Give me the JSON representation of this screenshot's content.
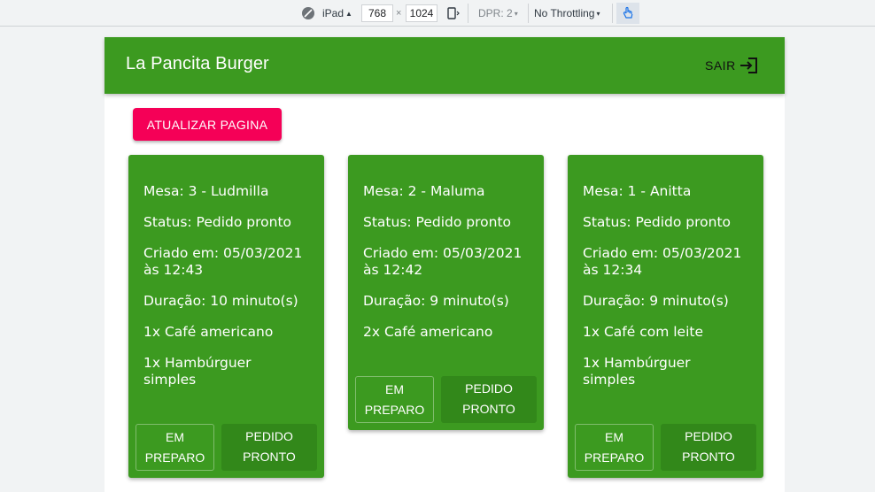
{
  "devtools": {
    "device": "iPad",
    "width": "768",
    "times": "×",
    "height": "1024",
    "dpr": "DPR: 2",
    "throttling": "No Throttling"
  },
  "app": {
    "title": "La Pancita Burger",
    "logout_label": "SAIR",
    "refresh_label": "ATUALIZAR PAGINA"
  },
  "orders": [
    {
      "table": "Mesa: 3 - Ludmilla",
      "status": "Status: Pedido pronto",
      "created_line1": "Criado em: 05/03/2021",
      "created_line2": "às 12:43",
      "duration": "Duração: 10 minuto(s)",
      "items": [
        {
          "line1": "1x Café americano",
          "line2": ""
        },
        {
          "line1": "1x Hambúrguer",
          "line2": "simples"
        }
      ],
      "btn_preparing_1": "EM",
      "btn_preparing_2": "PREPARO",
      "btn_ready_1": "PEDIDO",
      "btn_ready_2": "PRONTO"
    },
    {
      "table": "Mesa: 2 - Maluma",
      "status": "Status: Pedido pronto",
      "created_line1": "Criado em: 05/03/2021",
      "created_line2": "às 12:42",
      "duration": "Duração: 9 minuto(s)",
      "items": [
        {
          "line1": "2x Café americano",
          "line2": ""
        }
      ],
      "btn_preparing_1": "EM",
      "btn_preparing_2": "PREPARO",
      "btn_ready_1": "PEDIDO",
      "btn_ready_2": "PRONTO"
    },
    {
      "table": "Mesa: 1 - Anitta",
      "status": "Status: Pedido pronto",
      "created_line1": "Criado em: 05/03/2021",
      "created_line2": "às 12:34",
      "duration": "Duração: 9 minuto(s)",
      "items": [
        {
          "line1": "1x Café com leite",
          "line2": ""
        },
        {
          "line1": "1x Hambúrguer",
          "line2": "simples"
        }
      ],
      "btn_preparing_1": "EM",
      "btn_preparing_2": "PREPARO",
      "btn_ready_1": "PEDIDO",
      "btn_ready_2": "PRONTO"
    }
  ],
  "colors": {
    "primary": "#3c9a20",
    "primary_dark": "#32881a",
    "accent": "#f50057"
  },
  "icons": {
    "rotate": "rotate-icon",
    "logout": "logout-icon",
    "touch": "touch-icon"
  }
}
